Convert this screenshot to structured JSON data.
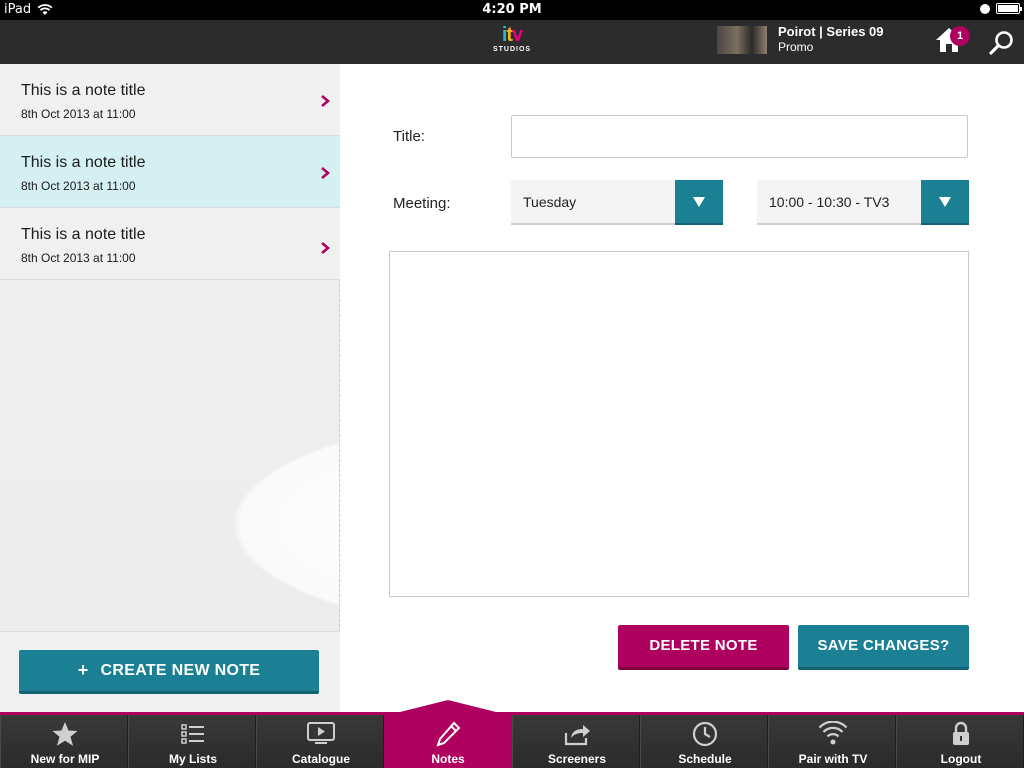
{
  "statusbar": {
    "carrier": "iPad",
    "time": "4:20 PM"
  },
  "header": {
    "logo_text": "itv",
    "logo_sub": "STUDIOS",
    "now_playing_title": "Poirot  |  Series 09",
    "now_playing_sub": "Promo",
    "home_badge": "1"
  },
  "sidebar": {
    "notes": [
      {
        "title": "This is a note title",
        "date": "8th Oct 2013 at 11:00",
        "selected": false
      },
      {
        "title": "This is a note title",
        "date": "8th Oct 2013 at 11:00",
        "selected": true
      },
      {
        "title": "This is a note title",
        "date": "8th Oct 2013 at 11:00",
        "selected": false
      }
    ],
    "create_label": "CREATE NEW NOTE"
  },
  "form": {
    "title_label": "Title:",
    "title_value": "",
    "meeting_label": "Meeting:",
    "day_value": "Tuesday",
    "slot_value": "10:00 - 10:30 - TV3",
    "notes_value": "",
    "delete_label": "DELETE NOTE",
    "save_label": "SAVE CHANGES?"
  },
  "tabs": [
    {
      "label": "New for MIP",
      "icon": "star-icon"
    },
    {
      "label": "My Lists",
      "icon": "list-icon"
    },
    {
      "label": "Catalogue",
      "icon": "tv-play-icon"
    },
    {
      "label": "Notes",
      "icon": "pencil-icon",
      "active": true
    },
    {
      "label": "Screeners",
      "icon": "share-icon"
    },
    {
      "label": "Schedule",
      "icon": "clock-icon"
    },
    {
      "label": "Pair with TV",
      "icon": "wifi-icon"
    },
    {
      "label": "Logout",
      "icon": "lock-icon"
    }
  ],
  "colors": {
    "accent_teal": "#1b8093",
    "accent_magenta": "#b0005f",
    "selected_row": "#d4f0f2",
    "header_bg": "#2c2c2c"
  }
}
